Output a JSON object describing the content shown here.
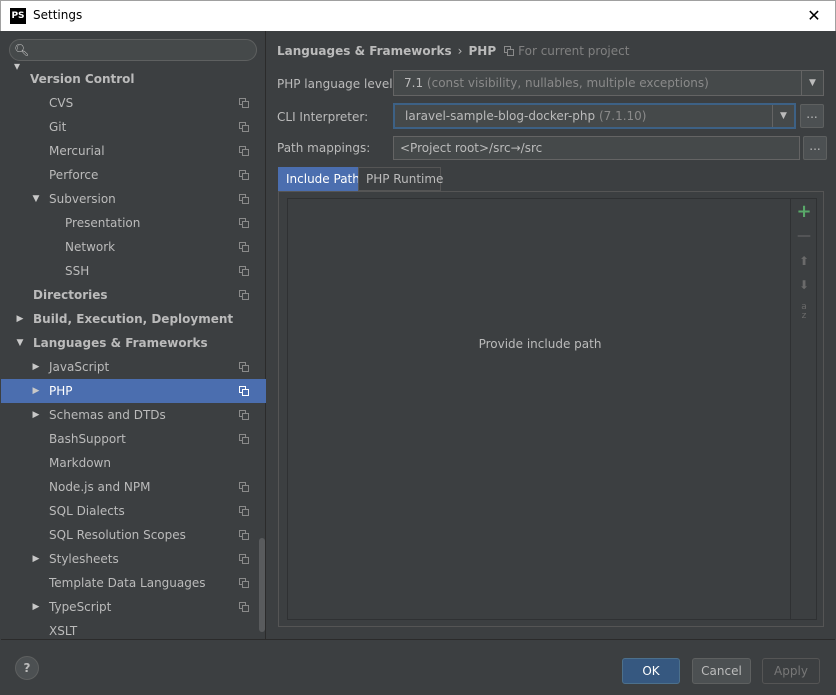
{
  "window": {
    "app_icon_text": "PS",
    "title": "Settings",
    "close_glyph": "✕"
  },
  "search": {
    "icon_glyph": "🔍︎▾",
    "value": ""
  },
  "sidebar": {
    "items": [
      {
        "label": "Version Control",
        "bold": true,
        "arrow": "",
        "copy": false
      },
      {
        "label": "CVS",
        "bold": false,
        "arrow": "",
        "copy": true
      },
      {
        "label": "Git",
        "bold": false,
        "arrow": "",
        "copy": true
      },
      {
        "label": "Mercurial",
        "bold": false,
        "arrow": "",
        "copy": true
      },
      {
        "label": "Perforce",
        "bold": false,
        "arrow": "",
        "copy": true
      },
      {
        "label": "Subversion",
        "bold": false,
        "arrow": "▼",
        "copy": true
      },
      {
        "label": "Presentation",
        "bold": false,
        "arrow": "",
        "copy": true
      },
      {
        "label": "Network",
        "bold": false,
        "arrow": "",
        "copy": true
      },
      {
        "label": "SSH",
        "bold": false,
        "arrow": "",
        "copy": true
      },
      {
        "label": "Directories",
        "bold": true,
        "arrow": "",
        "copy": true
      },
      {
        "label": "Build, Execution, Deployment",
        "bold": true,
        "arrow": "▶",
        "copy": false
      },
      {
        "label": "Languages & Frameworks",
        "bold": true,
        "arrow": "▼",
        "copy": false
      },
      {
        "label": "JavaScript",
        "bold": false,
        "arrow": "▶",
        "copy": true
      },
      {
        "label": "PHP",
        "bold": false,
        "arrow": "▶",
        "copy": true,
        "selected": true
      },
      {
        "label": "Schemas and DTDs",
        "bold": false,
        "arrow": "▶",
        "copy": true
      },
      {
        "label": "BashSupport",
        "bold": false,
        "arrow": "",
        "copy": true
      },
      {
        "label": "Markdown",
        "bold": false,
        "arrow": "",
        "copy": false
      },
      {
        "label": "Node.js and NPM",
        "bold": false,
        "arrow": "",
        "copy": true
      },
      {
        "label": "SQL Dialects",
        "bold": false,
        "arrow": "",
        "copy": true
      },
      {
        "label": "SQL Resolution Scopes",
        "bold": false,
        "arrow": "",
        "copy": true
      },
      {
        "label": "Stylesheets",
        "bold": false,
        "arrow": "▶",
        "copy": true
      },
      {
        "label": "Template Data Languages",
        "bold": false,
        "arrow": "",
        "copy": true
      },
      {
        "label": "TypeScript",
        "bold": false,
        "arrow": "▶",
        "copy": true
      },
      {
        "label": "XSLT",
        "bold": false,
        "arrow": "",
        "copy": false
      }
    ]
  },
  "breadcrumb": {
    "parent": "Languages & Frameworks",
    "separator": "›",
    "current": "PHP",
    "scope": "For current project"
  },
  "form": {
    "language_level_label": "PHP language level:",
    "language_level_value": "7.1",
    "language_level_detail": "(const visibility, nullables, multiple exceptions)",
    "cli_label": "CLI Interpreter:",
    "cli_value": "laravel-sample-blog-docker-php",
    "cli_version": "(7.1.10)",
    "path_label": "Path mappings:",
    "path_value": "<Project root>/src→/src",
    "browse_glyph": "..."
  },
  "tabs": [
    {
      "label": "Include Path",
      "active": true
    },
    {
      "label": "PHP Runtime",
      "active": false
    }
  ],
  "include_path": {
    "empty_text": "Provide include path",
    "toolbar": {
      "add": "+",
      "remove": "—",
      "up": "⬆",
      "down": "⬇",
      "sort_top": "a",
      "sort_bottom": "z"
    }
  },
  "footer": {
    "help": "?",
    "ok": "OK",
    "cancel": "Cancel",
    "apply": "Apply"
  },
  "colors": {
    "background": "#3c3f41",
    "selection": "#4b6eaf",
    "primary_button": "#365880",
    "add_icon": "#59a869"
  }
}
